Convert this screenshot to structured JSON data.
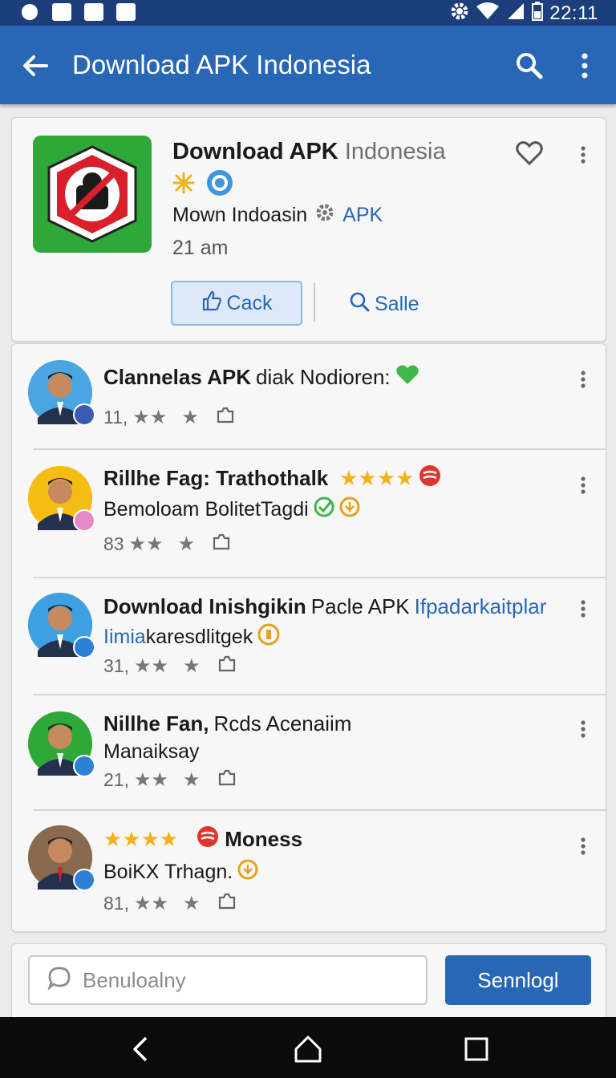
{
  "status_bar": {
    "time": "22:11"
  },
  "app_bar": {
    "title": "Download APK Indonesia"
  },
  "header": {
    "title_bold": "Download APK",
    "title_light": "Indonesia",
    "subtitle": "Mown Indoasin",
    "subtitle_tag": "APK",
    "time": "21 am",
    "back_button": "Cack",
    "sale_button": "Salle"
  },
  "items": [
    {
      "title": "Clannelas APK",
      "title_rest": "diak Nodioren:",
      "meta": "11,",
      "avatar_color": "#4aa6e0",
      "badge_color": "#3b5bb3"
    },
    {
      "title": "Rillhe Fag: Trathothalk",
      "line2": "Bemoloam BolitetTagdi",
      "meta": "83",
      "avatar_color": "#f5bd12",
      "badge_color": "#e58ac8"
    },
    {
      "title": "Download Inishgikin",
      "title_rest": "Pacle APK",
      "title_link": "Ifpadarkaitplar",
      "line2_link": "Iimia",
      "line2": "karesdlitgek",
      "meta": "31,",
      "avatar_color": "#3ea0e0",
      "badge_color": "#2e7fd6"
    },
    {
      "title": "Nillhe Fan,",
      "title_rest": "Rcds Acenaiim",
      "line2": "Manaiksay",
      "meta": "21,",
      "avatar_color": "#2fa83a",
      "badge_color": "#2e7fd6"
    },
    {
      "title": "Moness",
      "line2": "BoiKX Trhagn.",
      "meta": "81,",
      "avatar_color": "#8a6a4e",
      "badge_color": "#2e7fd6"
    }
  ],
  "composer": {
    "placeholder": "Benuloalny",
    "send_label": "Sennlogl"
  },
  "colors": {
    "primary": "#2767b6",
    "status_bar": "#1c3e7a",
    "star": "#f2b21a"
  }
}
